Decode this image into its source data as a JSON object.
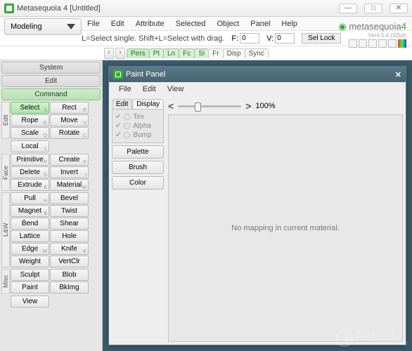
{
  "window": {
    "title": "Metasequoia 4 [Untitled]"
  },
  "menubar": [
    "File",
    "Edit",
    "Attribute",
    "Selected",
    "Object",
    "Panel",
    "Help"
  ],
  "mode": {
    "label": "Modeling"
  },
  "hintbar": {
    "text": "L=Select single.  Shift+L=Select with drag.",
    "f_label": "F:",
    "f_value": "0",
    "v_label": "V:",
    "v_value": "0",
    "sellock": "Sel Lock"
  },
  "brand": {
    "name_pre": "metasequoia",
    "name_num": "4",
    "version": "Ver4.5.4 (32bit)"
  },
  "viewtabs": {
    "nav_prev": "‹",
    "nav_next": "›",
    "items": [
      {
        "label": "Pers",
        "sel": true
      },
      {
        "label": "Pt"
      },
      {
        "label": "Ln"
      },
      {
        "label": "Fc"
      },
      {
        "label": "Si"
      },
      {
        "label": "Fr",
        "w": true
      },
      {
        "label": "Disp",
        "w": true
      },
      {
        "label": "Sync",
        "w": true
      }
    ]
  },
  "sidebar": {
    "system": "System",
    "edit": "Edit",
    "command": "Command",
    "groups": [
      {
        "cat": "Edit",
        "rows": 3,
        "tools": [
          {
            "l": "Select",
            "k": "S",
            "sel": true
          },
          {
            "l": "Rect",
            "k": "R"
          },
          {
            "l": "Rope",
            "k": "G"
          },
          {
            "l": "Move",
            "k": "V"
          },
          {
            "l": "Scale",
            "k": "Q"
          },
          {
            "l": "Rotate",
            "k": "C"
          }
        ],
        "extra": [
          {
            "l": "Local",
            "k": "L"
          }
        ]
      },
      {
        "cat": "Face",
        "rows": 3,
        "tools": [
          {
            "l": "Primitive",
            "k": "P"
          },
          {
            "l": "Create",
            "k": "F"
          },
          {
            "l": "Delete",
            "k": "D"
          },
          {
            "l": "Invert",
            "k": "I"
          },
          {
            "l": "Extrude",
            "k": "E"
          },
          {
            "l": "Material",
            "k": "M"
          }
        ]
      },
      {
        "cat": "L&W",
        "rows": 6,
        "tools": [
          {
            "l": "Pull",
            "k": "H"
          },
          {
            "l": "Bevel"
          },
          {
            "l": "Magnet",
            "k": "B"
          },
          {
            "l": "Twist"
          },
          {
            "l": "Bend"
          },
          {
            "l": "Shear"
          },
          {
            "l": "Lattice"
          },
          {
            "l": "Hole"
          },
          {
            "l": "Edge",
            "k": "W"
          },
          {
            "l": "Knife",
            "k": "K"
          },
          {
            "l": "Weight"
          },
          {
            "l": "VertClr"
          }
        ]
      },
      {
        "cat": "Misc",
        "rows": 3,
        "tools": [
          {
            "l": "Sculpt"
          },
          {
            "l": "Blob"
          },
          {
            "l": "Paint"
          },
          {
            "l": "BkImg"
          }
        ],
        "extra": [
          {
            "l": "View"
          }
        ]
      }
    ]
  },
  "paint_panel": {
    "title": "Paint Panel",
    "menu": [
      "File",
      "Edit",
      "View"
    ],
    "tabs": {
      "edit": "Edit",
      "display": "Display"
    },
    "checks": [
      {
        "l": "Tex"
      },
      {
        "l": "Alpha"
      },
      {
        "l": "Bump"
      }
    ],
    "buttons": {
      "palette": "Palette",
      "brush": "Brush",
      "color": "Color"
    },
    "zoom_prev": "<",
    "zoom_next": ">",
    "zoom_value": "100%",
    "canvas_msg": "No mapping in current material."
  },
  "watermark": "当下软件园\nwww.downxia.com"
}
